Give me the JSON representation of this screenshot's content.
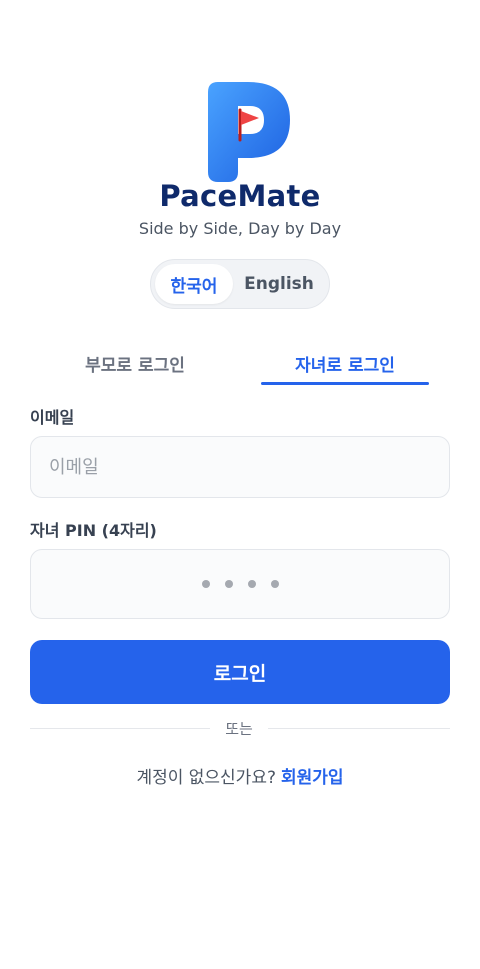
{
  "brand": {
    "name": "PaceMate",
    "tagline": "Side by Side, Day by Day"
  },
  "language_toggle": {
    "korean": "한국어",
    "english": "English",
    "selected": "한국어"
  },
  "tabs": {
    "parent_login": "부모로 로그인",
    "child_login": "자녀로 로그인",
    "active": "자녀로 로그인"
  },
  "form": {
    "email_label": "이메일",
    "email_placeholder": "이메일",
    "email_value": "",
    "pin_label": "자녀 PIN (4자리)",
    "pin_digits": 4
  },
  "login_button": "로그인",
  "divider_text": "또는",
  "signup": {
    "prompt": "계정이 없으신가요?",
    "link": "회원가입"
  },
  "colors": {
    "accent": "#2563eb",
    "brand_dark": "#0f2a6b",
    "flag": "#ef4444"
  },
  "icons": {
    "logo": "pacemate-p-flag-logo"
  }
}
